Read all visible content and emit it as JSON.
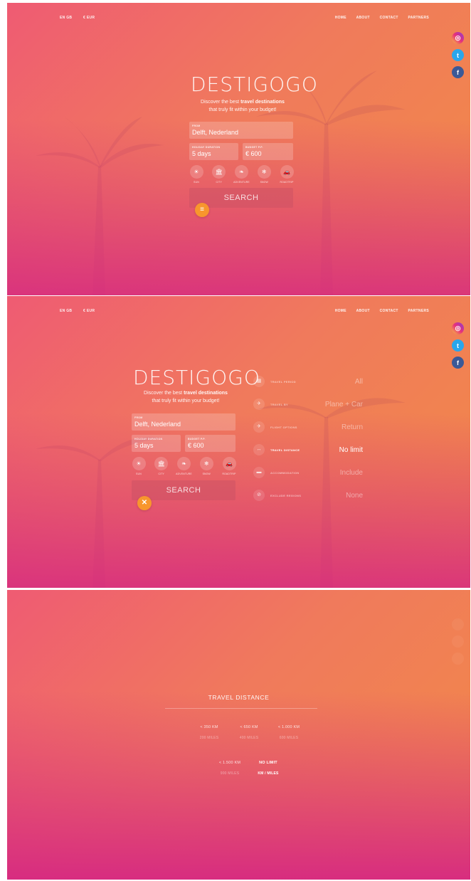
{
  "topbar": {
    "left": [
      "EN GB",
      "€ EUR"
    ],
    "nav": [
      "HOME",
      "ABOUT",
      "CONTACT",
      "PARTNERS"
    ]
  },
  "social": {
    "instagram": "instagram-icon",
    "twitter": "twitter-icon",
    "facebook": "facebook-icon"
  },
  "brand": "DESTIGOGO",
  "tagline": {
    "line1_pre": "Discover the best ",
    "line1_bold": "travel destinations",
    "line2": "that truly fit within your budget!"
  },
  "form": {
    "from_label": "FROM",
    "from_value": "Delft, Nederland",
    "duration_label": "HOLIDAY DURATION",
    "duration_value": "5 days",
    "budget_label": "BUDGET P.P.",
    "budget_value": "€ 600",
    "search_label": "SEARCH"
  },
  "categories": [
    {
      "icon": "sun-icon",
      "glyph": "☀",
      "label": "SUN"
    },
    {
      "icon": "city-icon",
      "glyph": "🏛",
      "label": "CITY"
    },
    {
      "icon": "leaf-icon",
      "glyph": "❧",
      "label": "ADVENTURE"
    },
    {
      "icon": "snow-icon",
      "glyph": "❄",
      "label": "SNOW"
    },
    {
      "icon": "car-icon",
      "glyph": "🚗",
      "label": "ROADTRIP"
    }
  ],
  "options": [
    {
      "icon": "calendar-icon",
      "glyph": "▦",
      "label": "TRAVEL PERIOD",
      "value": "All"
    },
    {
      "icon": "plane-icon",
      "glyph": "✈",
      "label": "TRAVEL BY",
      "value": "Plane + Car"
    },
    {
      "icon": "flight-icon",
      "glyph": "✈",
      "label": "FLIGHT OPTIONS",
      "value": "Return"
    },
    {
      "icon": "distance-icon",
      "glyph": "↔",
      "label": "TRAVEL DISTANCE",
      "value": "No limit"
    },
    {
      "icon": "bed-icon",
      "glyph": "▬",
      "label": "ACCOMMODATION",
      "value": "Include"
    },
    {
      "icon": "block-icon",
      "glyph": "⊘",
      "label": "EXCLUDE REGIONS",
      "value": "None"
    }
  ],
  "travel_distance": {
    "title": "TRAVEL DISTANCE",
    "row1": [
      {
        "km": "< 350 KM",
        "mi": "200 MILES"
      },
      {
        "km": "< 650 KM",
        "mi": "400 MILES"
      },
      {
        "km": "< 1.000 KM",
        "mi": "600 MILES"
      }
    ],
    "row2": [
      {
        "km": "< 1.500 KM",
        "mi": "900 MILES"
      },
      {
        "km": "NO LIMIT",
        "mi": "KM / MILES"
      }
    ]
  },
  "colors": {
    "gradient_top_right": "#f28a46",
    "gradient_bottom_left": "#d62882",
    "fab": "#f8962d"
  }
}
